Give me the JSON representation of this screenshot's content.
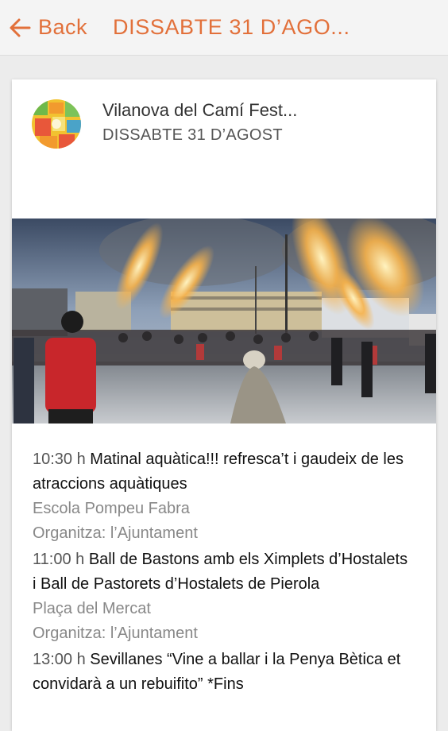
{
  "topbar": {
    "back_label": "Back",
    "title": "DISSABTE 31 D’AGO...",
    "accent": "#e2703a"
  },
  "card": {
    "org_name": "Vilanova del Camí Fest...",
    "date": "DISSABTE 31 D’AGOST",
    "avatar_icon": "festival-logo-icon",
    "image_alt_icon": "festival-photo"
  },
  "schedule": [
    {
      "time": "10:30 h",
      "title": "Matinal aquàtica!!! refresca’t i gaudeix de les atraccions aquàtiques",
      "place": "Escola Pompeu Fabra",
      "org": "Organitza: l’Ajuntament"
    },
    {
      "time": "11:00 h",
      "title": "Ball de Bastons amb els Ximplets d’Hostalets i Ball de Pastorets d’Hostalets de Pierola",
      "place": "Plaça del Mercat",
      "org": "Organitza: l’Ajuntament"
    },
    {
      "time": "13:00 h",
      "title": "Sevillanes “Vine a ballar i la Penya Bètica et convidarà a un rebuifito” *Fins",
      "place": "",
      "org": ""
    }
  ]
}
